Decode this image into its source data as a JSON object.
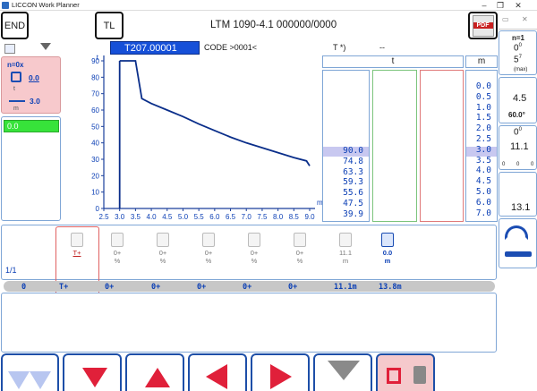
{
  "window": {
    "title": "LICCON Work Planner"
  },
  "header": {
    "end_label": "END",
    "tl_label": "TL",
    "crane_title": "LTM 1090-4.1  000000/0000",
    "pdf_label": "PDF"
  },
  "left": {
    "n_label": "n=0x",
    "hook_value": "0.0",
    "t_unit": "t",
    "radius_value": "3.0",
    "m_unit": "m",
    "green_value": "0.0"
  },
  "chart_header": {
    "code": "T207.00001",
    "code_label": "CODE >0001<",
    "t_label": "T *)",
    "dash": "--"
  },
  "chart_data": {
    "type": "line",
    "title": "",
    "ylabel": "t",
    "xlabel": "m",
    "ylim": [
      0,
      90
    ],
    "xlim": [
      2.5,
      9.0
    ],
    "y_ticks": [
      "0",
      "10",
      "20",
      "30",
      "40",
      "50",
      "60",
      "70",
      "80",
      "90"
    ],
    "x_ticks": [
      "2.5",
      "3.0",
      "3.5",
      "4.0",
      "4.5",
      "5.0",
      "5.5",
      "6.0",
      "6.5",
      "7.0",
      "7.5",
      "8.0",
      "8.5",
      "9.0"
    ],
    "x": [
      3.0,
      3.5,
      3.7,
      4.0,
      4.5,
      5.0,
      5.5,
      6.0,
      6.5,
      7.0,
      7.5,
      8.0,
      8.5,
      8.9,
      9.0
    ],
    "y": [
      90,
      90,
      67,
      64,
      60,
      56,
      51.5,
      47.5,
      43.5,
      40,
      37,
      34,
      31,
      29,
      26
    ],
    "color": "#0a2e8a"
  },
  "table": {
    "t_header": "t",
    "m_header": "m",
    "t_values": [
      "90.0",
      "74.8",
      "63.3",
      "59.3",
      "55.6",
      "47.5",
      "39.9"
    ],
    "m_values": [
      "0.0",
      "0.5",
      "1.0",
      "1.5",
      "2.0",
      "2.5",
      "3.0",
      "3.5",
      "4.0",
      "4.5",
      "5.0",
      "6.0",
      "7.0"
    ],
    "highlight_color": "#c8c8f0"
  },
  "right": {
    "n_label": "n=1",
    "deg1": "0",
    "deg1_sup": "0",
    "five": "5",
    "five_sup": "7",
    "max_label": "(max)",
    "val45": "4.5",
    "deg60": "60.0°",
    "deg0b": "0",
    "deg0b_sup": "0",
    "val111": "11.1",
    "zeros": [
      "0",
      "0",
      "0"
    ],
    "val131": "13.1"
  },
  "modes": {
    "page": "1/1",
    "items": [
      {
        "name": "T+",
        "v1": "T+",
        "v2": ""
      },
      {
        "name": "1",
        "v1": "0+",
        "v2": "%"
      },
      {
        "name": "2",
        "v1": "0+",
        "v2": "%"
      },
      {
        "name": "3",
        "v1": "0+",
        "v2": "%"
      },
      {
        "name": "4",
        "v1": "0+",
        "v2": "%"
      },
      {
        "name": "5",
        "v1": "0+",
        "v2": "%"
      },
      {
        "name": "boom",
        "v1": "11.1",
        "v2": "m"
      },
      {
        "name": "radius",
        "v1": "0.0",
        "v2": "m"
      }
    ],
    "row": [
      "0",
      "T+",
      "0+",
      "0+",
      "0+",
      "0+",
      "0+",
      "11.1m",
      "13.8m"
    ]
  }
}
